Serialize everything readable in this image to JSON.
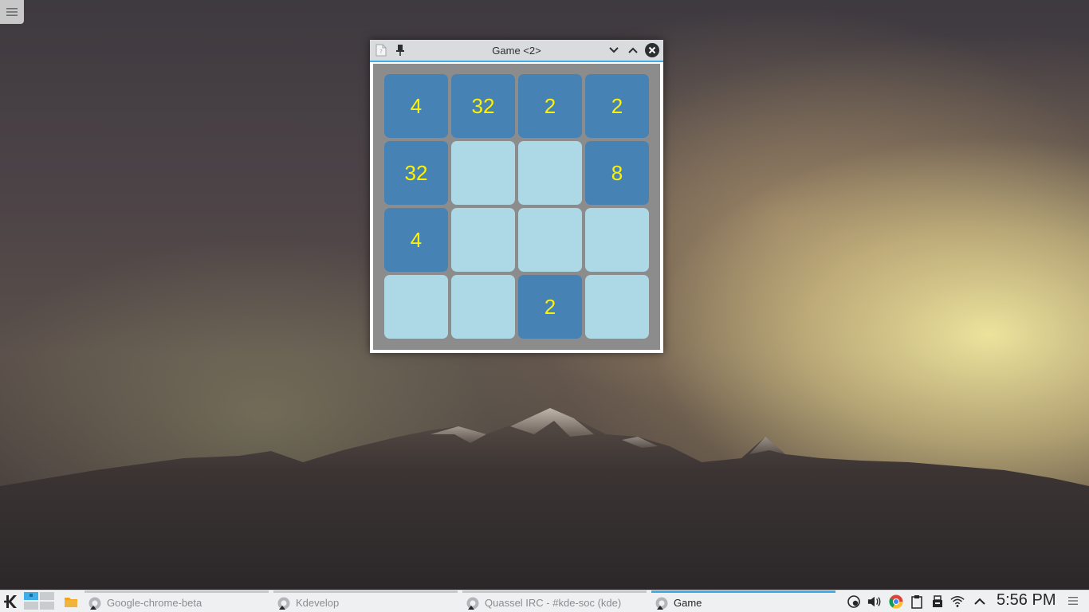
{
  "window": {
    "title": "Game <2>",
    "board": [
      [
        "4",
        "32",
        "2",
        "2"
      ],
      [
        "32",
        "",
        "",
        "8"
      ],
      [
        "4",
        "",
        "",
        ""
      ],
      [
        "",
        "",
        "2",
        ""
      ]
    ],
    "colors": {
      "filled_tile": "#4682b4",
      "empty_tile": "#add8e6",
      "tile_text": "#fff200",
      "board_background": "#8c8c8c"
    }
  },
  "taskbar": {
    "tasks": [
      {
        "label": "Google-chrome-beta",
        "icon": "chrome-task-icon",
        "active": false
      },
      {
        "label": "Kdevelop",
        "icon": "kdevelop-task-icon",
        "active": false
      },
      {
        "label": "Quassel IRC - #kde-soc (kde)",
        "icon": "quassel-task-icon",
        "active": false
      },
      {
        "label": "Game",
        "icon": "game-task-icon",
        "active": true
      }
    ],
    "clock": "5:56 PM",
    "accent_color": "#3daee9"
  }
}
